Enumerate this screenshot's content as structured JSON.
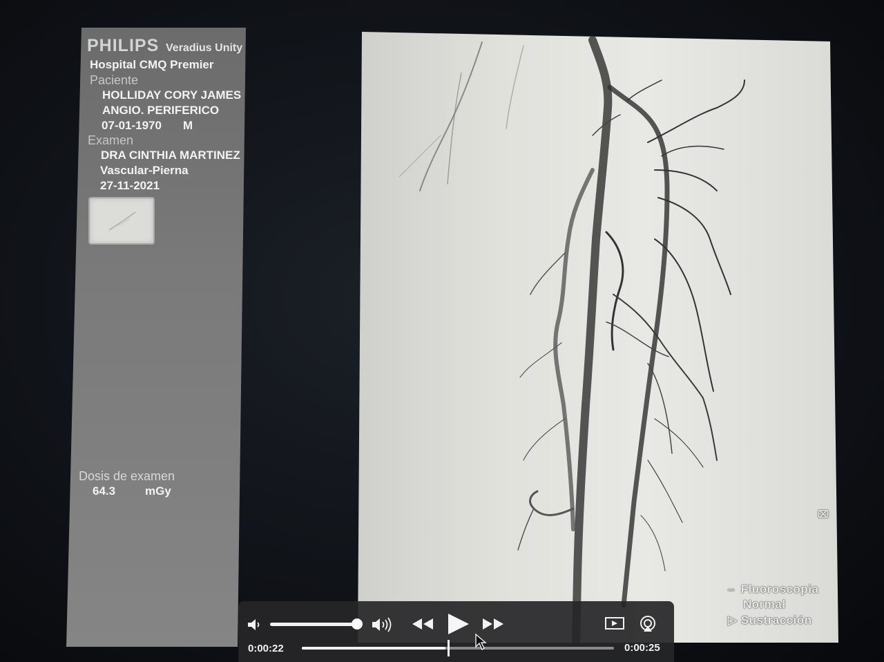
{
  "panel": {
    "brand": "PHILIPS",
    "product": "Veradius Unity",
    "hospital": "Hospital CMQ Premier",
    "patient_label": "Paciente",
    "patient_name": "HOLLIDAY CORY JAMES",
    "procedure": "ANGIO. PERIFERICO",
    "birth_date": "07-01-1970",
    "sex": "M",
    "exam_label": "Examen",
    "doctor": "DRA CINTHIA MARTINEZ",
    "exam_type": "Vascular-Pierna",
    "exam_date": "27-11-2021",
    "dose_label": "Dosis de examen",
    "dose_value": "64.3",
    "dose_unit": "mGy"
  },
  "image_overlay": {
    "mode1": "Fluoroscopia",
    "mode2": "Normal",
    "mode3": "Sustracción"
  },
  "player": {
    "elapsed": "0:00:22",
    "remaining": "0:00:25",
    "volume_level": 1.0,
    "progress": 0.46,
    "icons": [
      "speaker-low-icon",
      "speaker-high-icon",
      "rewind-icon",
      "play-icon",
      "fast-forward-icon",
      "pip-icon",
      "airplay-icon"
    ]
  }
}
